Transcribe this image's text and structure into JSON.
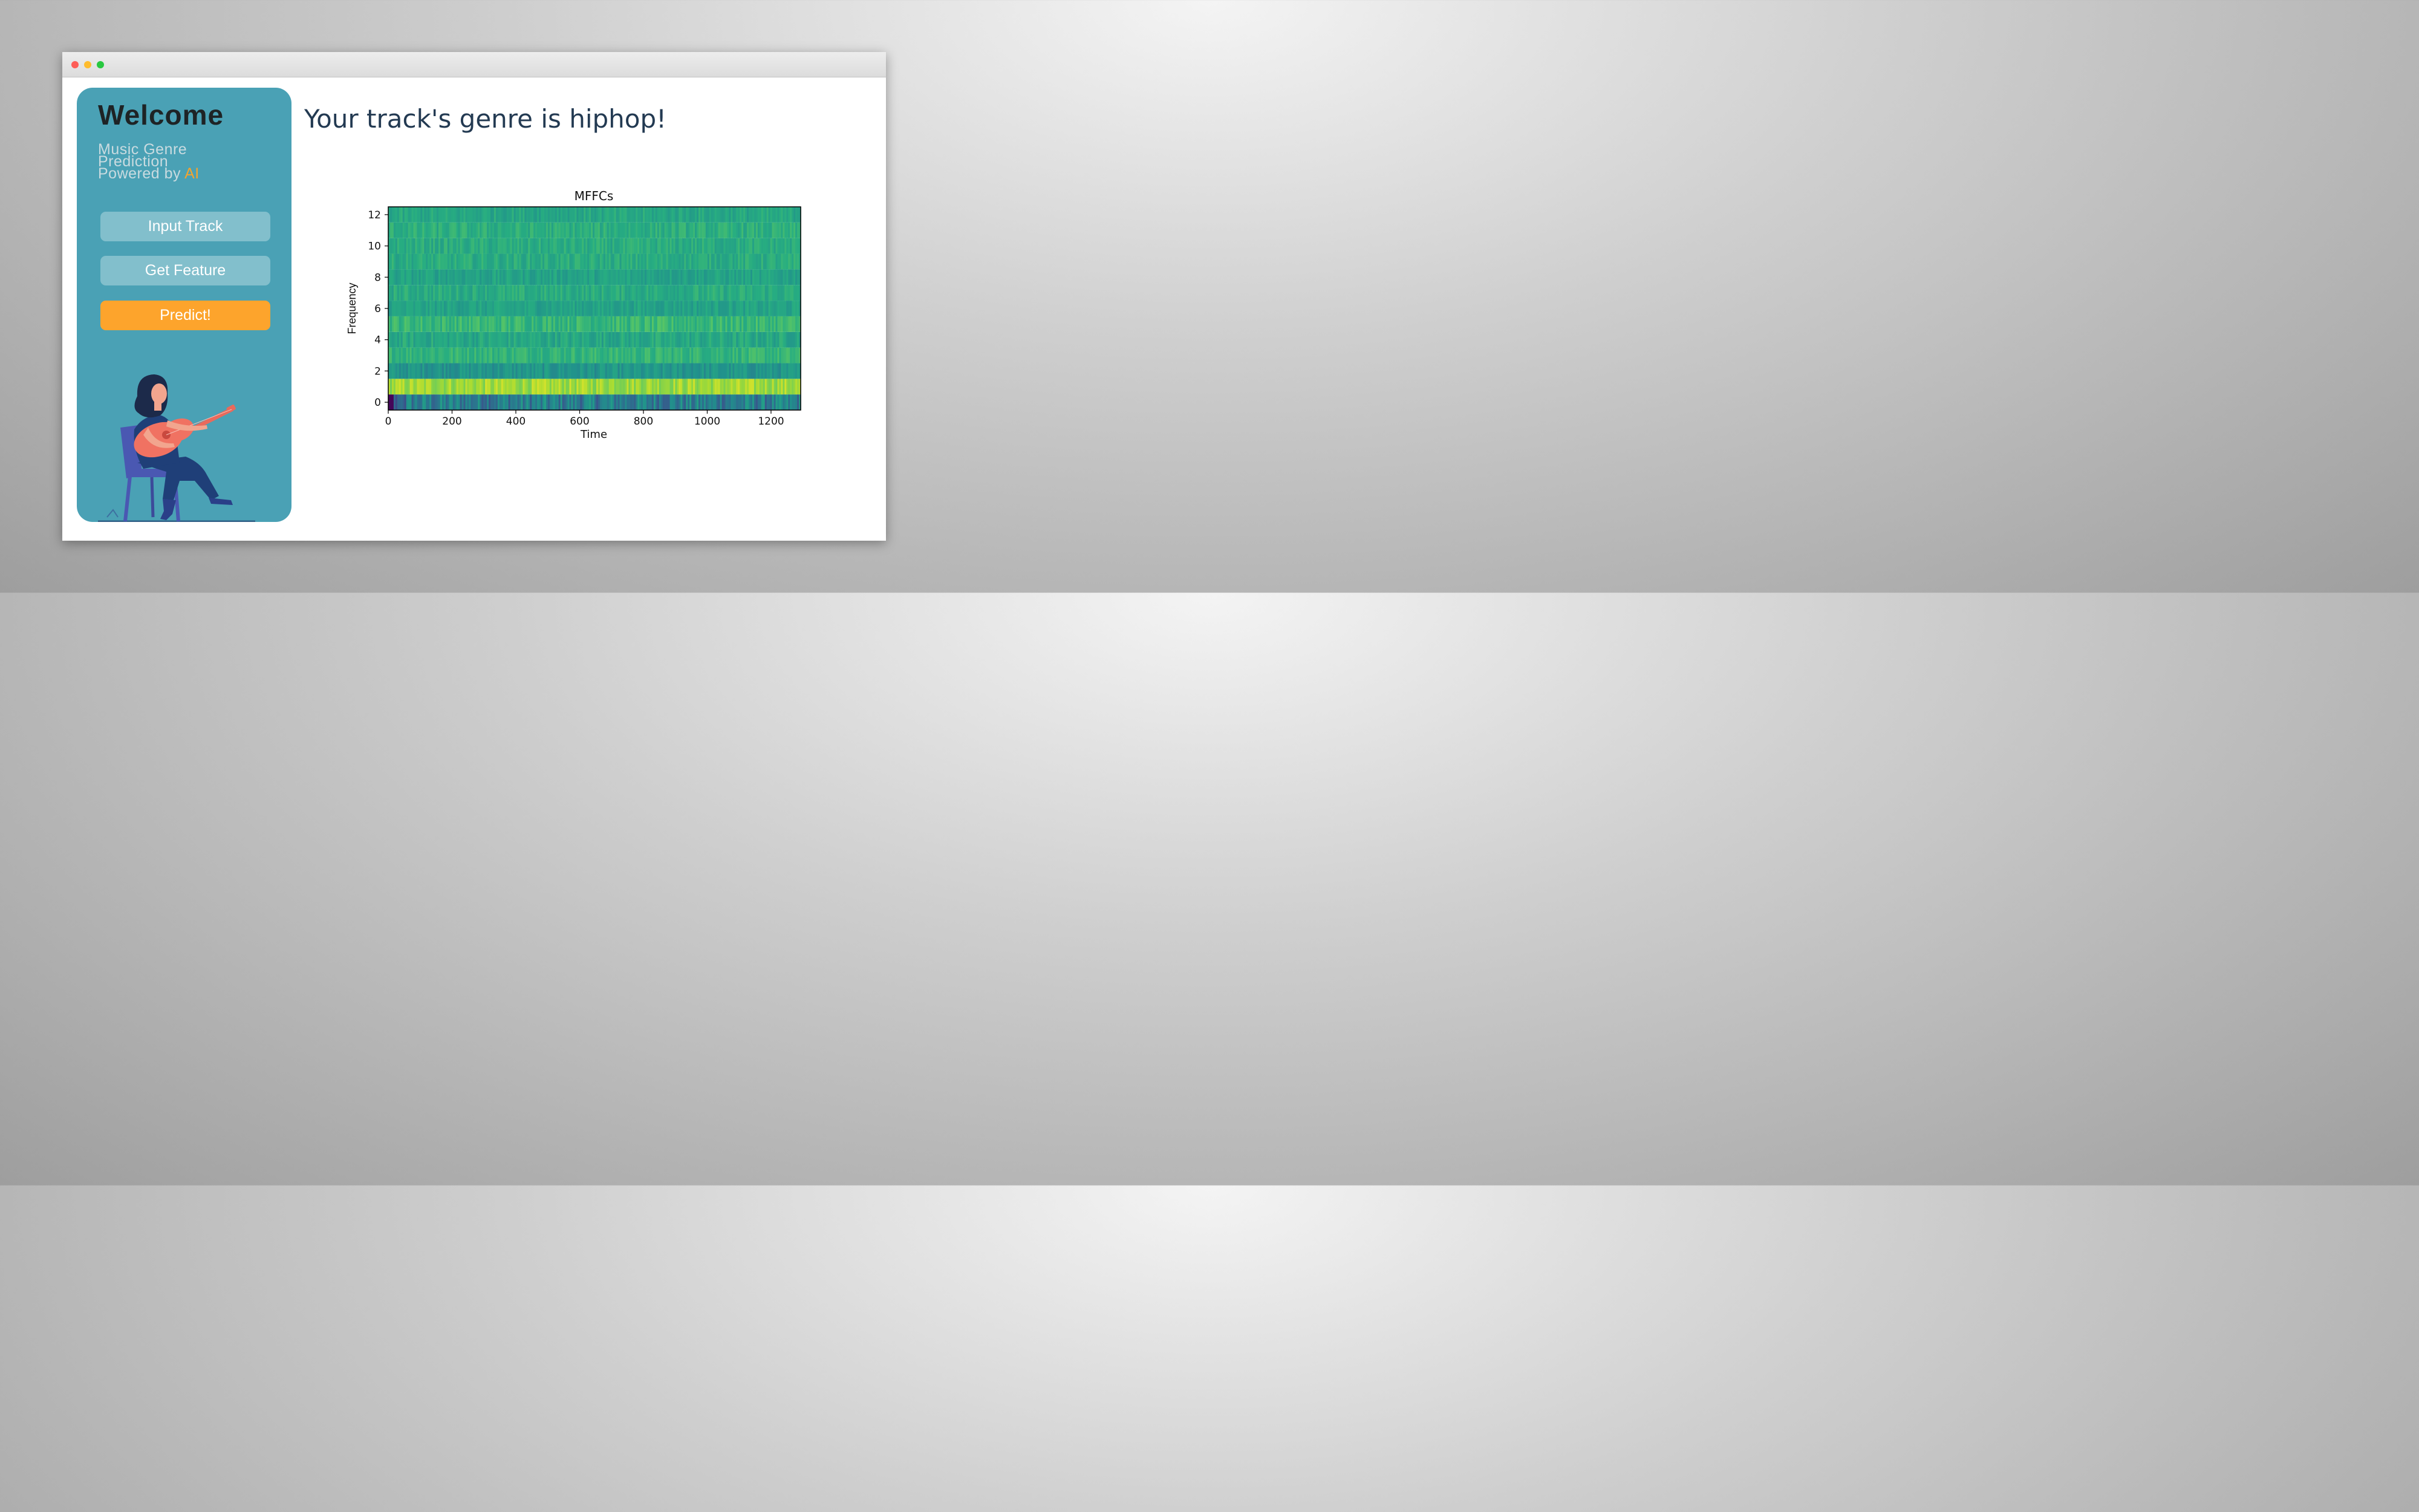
{
  "window": {
    "controls": [
      "close",
      "minimize",
      "maximize"
    ]
  },
  "sidebar": {
    "welcome": "Welcome",
    "tagline_line1": "Music Genre",
    "tagline_line2": "Prediction",
    "tagline_line3_prefix": "Powered by ",
    "tagline_ai": "AI",
    "buttons": {
      "input_track": "Input Track",
      "get_feature": "Get Feature",
      "predict": "Predict!"
    },
    "colors": {
      "panel": "#4aa1b5",
      "accent": "#fda42c",
      "button": "#82bfcc"
    },
    "illustration_icon": "woman-playing-guitar-illustration"
  },
  "main": {
    "result_heading": "Your track's genre is hiphop!"
  },
  "chart_data": {
    "type": "heatmap",
    "title": "MFFCs",
    "xlabel": "Time",
    "ylabel": "Frequency",
    "xlim": [
      0,
      1293
    ],
    "ylim": [
      -0.5,
      12.5
    ],
    "xticks": [
      0,
      200,
      400,
      600,
      800,
      1000,
      1200
    ],
    "yticks": [
      0,
      2,
      4,
      6,
      8,
      10,
      12
    ],
    "rows": 13,
    "columns": 1293,
    "colormap": "viridis",
    "grid": false,
    "row_mean_level": [
      0.42,
      0.86,
      0.52,
      0.66,
      0.6,
      0.67,
      0.58,
      0.62,
      0.58,
      0.62,
      0.62,
      0.63,
      0.6
    ],
    "row_variation": [
      0.15,
      0.08,
      0.07,
      0.06,
      0.07,
      0.07,
      0.06,
      0.06,
      0.06,
      0.06,
      0.06,
      0.06,
      0.06
    ]
  }
}
